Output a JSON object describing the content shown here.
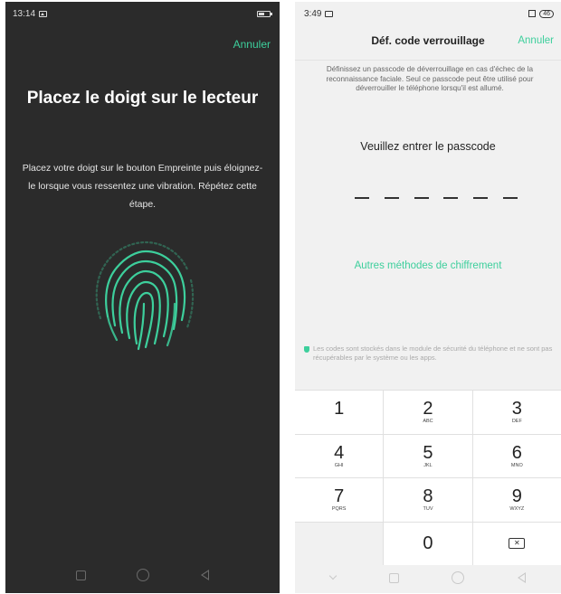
{
  "left_screen": {
    "status": {
      "time": "13:14"
    },
    "cancel_label": "Annuler",
    "title": "Placez le doigt sur le lecteur",
    "description": "Placez votre doigt sur le bouton Empreinte puis éloignez-le lorsque vous ressentez une vibration. Répétez cette étape.",
    "accent_color": "#3dcf9c",
    "icons": [
      "fingerprint-icon",
      "recents-icon",
      "home-icon",
      "back-icon"
    ]
  },
  "right_screen": {
    "status": {
      "time": "3:49",
      "battery": "46"
    },
    "header": {
      "title": "Déf. code verrouillage",
      "cancel_label": "Annuler"
    },
    "info_text": "Définissez un passcode de déverrouillage en cas d'échec de la reconnaissance faciale. Seul ce passcode peut être utilisé pour déverrouiller le téléphone lorsqu'il est allumé.",
    "prompt": "Veuillez entrer le passcode",
    "passcode_length": 6,
    "other_methods_label": "Autres méthodes de chiffrement",
    "security_note": "Les codes sont stockés dans le module de sécurité du téléphone et ne sont pas récupérables par le système ou les apps.",
    "keypad": [
      {
        "num": "1",
        "letters": ""
      },
      {
        "num": "2",
        "letters": "ABC"
      },
      {
        "num": "3",
        "letters": "DEF"
      },
      {
        "num": "4",
        "letters": "GHI"
      },
      {
        "num": "5",
        "letters": "JKL"
      },
      {
        "num": "6",
        "letters": "MNO"
      },
      {
        "num": "7",
        "letters": "PQRS"
      },
      {
        "num": "8",
        "letters": "TUV"
      },
      {
        "num": "9",
        "letters": "WXYZ"
      },
      {
        "num": "",
        "letters": ""
      },
      {
        "num": "0",
        "letters": ""
      },
      {
        "num": "",
        "letters": ""
      }
    ],
    "accent_color": "#3dcf9c"
  }
}
